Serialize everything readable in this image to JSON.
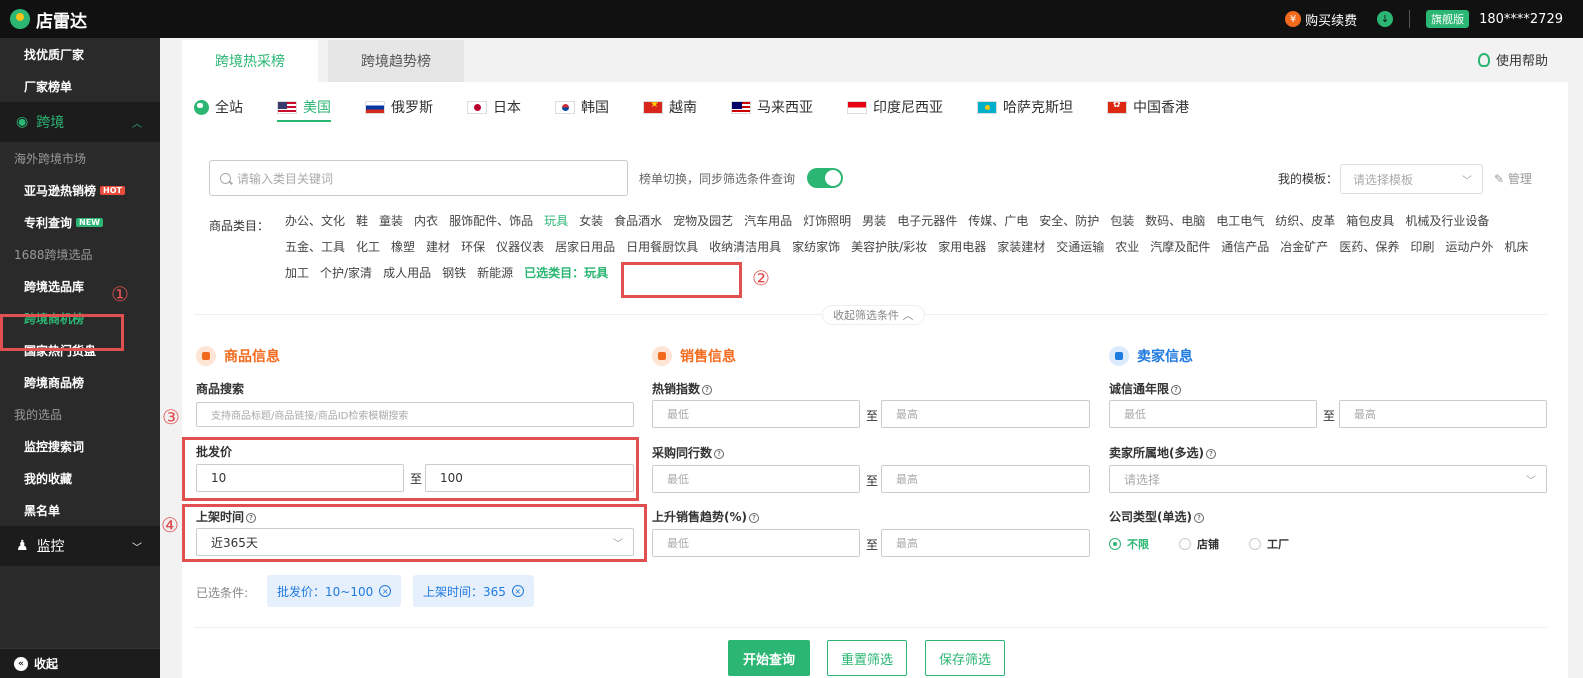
{
  "topbar": {
    "logo_text": "店雷达",
    "buy_label": "购买续费",
    "yen_symbol": "¥",
    "flag_badge": "旗舰版",
    "phone": "180****2729"
  },
  "sidebar": {
    "items": [
      {
        "label": "找优质厂家"
      },
      {
        "label": "厂家榜单"
      }
    ],
    "cross_border": "跨境",
    "group_overseas": "海外跨境市场",
    "amazon": "亚马逊热销榜",
    "amazon_badge": "HOT",
    "patent": "专利查询",
    "patent_badge": "NEW",
    "group_1688": "1688跨境选品",
    "lib": "跨境选品库",
    "opportunity": "跨境商机榜",
    "hot_country": "国家热门货盘",
    "goods_rank": "跨境商品榜",
    "group_my": "我的选品",
    "monitor_search": "监控搜索词",
    "favorites": "我的收藏",
    "blacklist": "黑名单",
    "monitor": "监控",
    "collapse": "收起"
  },
  "annotations": {
    "n1": "①",
    "n2": "②",
    "n3": "③",
    "n4": "④"
  },
  "main": {
    "tabs": [
      "跨境热采榜",
      "跨境趋势榜"
    ],
    "help": "使用帮助",
    "countries": [
      "全站",
      "美国",
      "俄罗斯",
      "日本",
      "韩国",
      "越南",
      "马来西亚",
      "印度尼西亚",
      "哈萨克斯坦",
      "中国香港"
    ],
    "search_placeholder": "请输入类目关键词",
    "switch_label": "榜单切换，同步筛选条件查询",
    "template_label": "我的模板：",
    "template_placeholder": "请选择模板",
    "manage": "管理",
    "category_label": "商品类目：",
    "categories": [
      "办公、文化",
      "鞋",
      "童装",
      "内衣",
      "服饰配件、饰品",
      "玩具",
      "女装",
      "食品酒水",
      "宠物及园艺",
      "汽车用品",
      "灯饰照明",
      "男装",
      "电子元器件",
      "传媒、广电",
      "安全、防护",
      "包装",
      "数码、电脑",
      "电工电气",
      "纺织、皮革",
      "箱包皮具",
      "机械及行业设备",
      "五金、工具",
      "化工",
      "橡塑",
      "建材",
      "环保",
      "仪器仪表",
      "居家日用品",
      "日用餐厨饮具",
      "收纳清洁用具",
      "家纺家饰",
      "美容护肤/彩妆",
      "家用电器",
      "家装建材",
      "交通运输",
      "农业",
      "汽摩及配件",
      "通信产品",
      "冶金矿产",
      "医药、保养",
      "印刷",
      "运动户外",
      "机床",
      "加工",
      "个护/家清",
      "成人用品",
      "钢铁",
      "新能源"
    ],
    "selected_category": "已选类目：玩具",
    "collapse_filters": "收起筛选条件 ︿"
  },
  "product_info": {
    "title": "商品信息",
    "search_label": "商品搜索",
    "search_placeholder": "支持商品标题/商品链接/商品ID检索模糊搜索",
    "price_label": "批发价",
    "price_min": "10",
    "price_max": "100",
    "to": "至",
    "listing_label": "上架时间",
    "listing_value": "近365天"
  },
  "sales_info": {
    "title": "销售信息",
    "hot_label": "热销指数",
    "peers_label": "采购同行数",
    "trend_label": "上升销售趋势(%)",
    "min_ph": "最低",
    "max_ph": "最高"
  },
  "seller_info": {
    "title": "卖家信息",
    "years_label": "诚信通年限",
    "location_label": "卖家所属地(多选)",
    "location_placeholder": "请选择",
    "company_label": "公司类型(单选)",
    "options": [
      "不限",
      "店铺",
      "工厂"
    ]
  },
  "selected_conditions": {
    "label": "已选条件:",
    "chip1": "批发价：10~100",
    "chip2": "上架时间：365"
  },
  "buttons": {
    "start": "开始查询",
    "reset": "重置筛选",
    "save": "保存筛选"
  },
  "colors": {
    "accent": "#2bb673",
    "orange": "#f26b1d",
    "blue": "#1f7ae0",
    "annotation_red": "#e05050"
  }
}
